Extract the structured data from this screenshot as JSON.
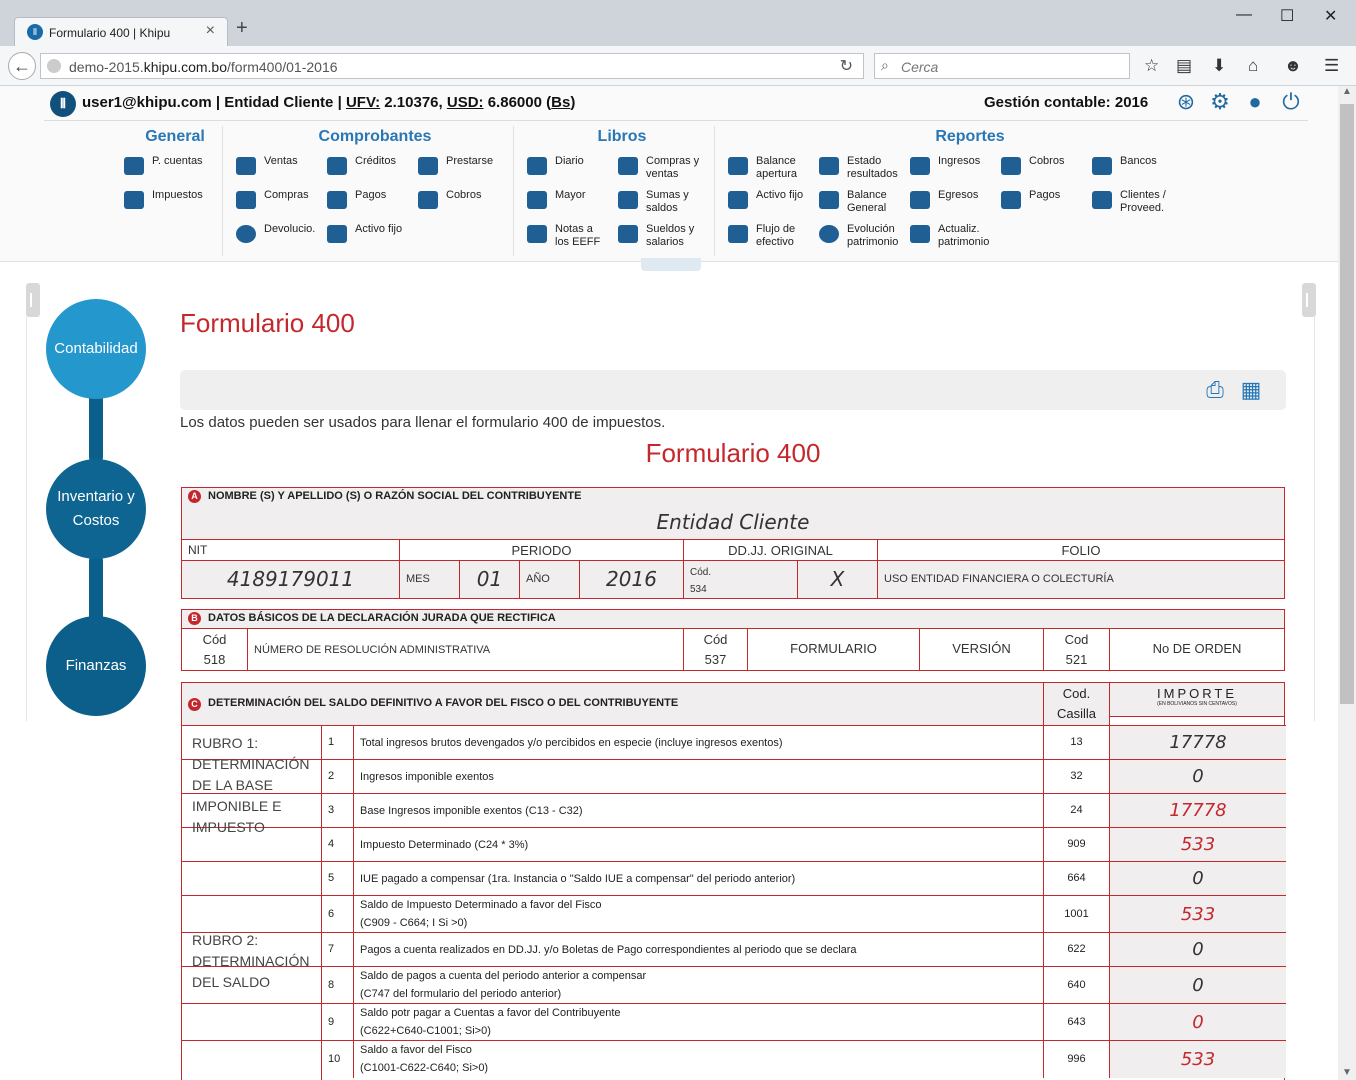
{
  "browser": {
    "tab_title": "Formulario 400 | Khipu",
    "url_prefix": "demo-2015.",
    "url_domain": "khipu.com.bo",
    "url_path": "/form400/01-2016",
    "search_placeholder": "Cerca"
  },
  "header": {
    "user": "user1@khipu.com",
    "entity": "Entidad Cliente",
    "ufv_label": "UFV:",
    "ufv_value": "2.10376",
    "usd_label": "USD:",
    "usd_value": "6.86000",
    "bs_label": "Bs",
    "gestion": "Gestión contable: 2016"
  },
  "menu": {
    "general": {
      "title": "General",
      "items": [
        "P. cuentas",
        "Impuestos"
      ]
    },
    "comprobantes": {
      "title": "Comprobantes",
      "items": [
        "Ventas",
        "Créditos",
        "Prestarse",
        "Compras",
        "Pagos",
        "Cobros",
        "Devolucio.",
        "Activo fijo"
      ]
    },
    "libros": {
      "title": "Libros",
      "items": [
        "Diario",
        "Compras y ventas",
        "Mayor",
        "Sumas y saldos",
        "Notas a los EEFF",
        "Sueldos y salarios"
      ]
    },
    "reportes": {
      "title": "Reportes",
      "items": [
        "Balance apertura",
        "Estado resultados",
        "Ingresos",
        "Cobros",
        "Bancos",
        "Activo fijo",
        "Balance General",
        "Egresos",
        "Pagos",
        "Clientes / Proveed.",
        "Flujo de efectivo",
        "Evolución patrimonio",
        "Actualiz. patrimonio"
      ]
    }
  },
  "sidebar": {
    "items": [
      "Contabilidad",
      "Inventario y Costos",
      "Finanzas"
    ],
    "colors": [
      "#2497cd",
      "#0f6591",
      "#0d5f8b"
    ]
  },
  "page": {
    "title": "Formulario 400",
    "description": "Los datos pueden ser usados para llenar el formulario 400 de impuestos.",
    "form_title": "Formulario 400"
  },
  "form": {
    "secA": {
      "badge": "A",
      "heading": "NOMBRE (S) Y APELLIDO (S) O RAZÓN SOCIAL DEL CONTRIBUYENTE",
      "name": "Entidad Cliente",
      "nit_label": "NIT",
      "periodo_label": "PERIODO",
      "ddjj_label": "DD.JJ. ORIGINAL",
      "folio_label": "FOLIO",
      "nit": "4189179011",
      "mes_label": "MES",
      "mes": "01",
      "anio_label": "AÑO",
      "anio": "2016",
      "cod_label": "Cód.",
      "cod": "534",
      "mark": "X",
      "folio_text": "USO ENTIDAD FINANCIERA O COLECTURÍA"
    },
    "secB": {
      "badge": "B",
      "heading": "DATOS BÁSICOS DE LA DECLARACIÓN JURADA QUE RECTIFICA",
      "cod1_label": "Cód",
      "cod1": "518",
      "resol": "NÚMERO DE RESOLUCIÓN ADMINISTRATIVA",
      "cod2_label": "Cód",
      "cod2": "537",
      "formulario": "FORMULARIO",
      "version": "VERSIÓN",
      "cod3_label": "Cod",
      "cod3": "521",
      "orden": "No DE ORDEN"
    },
    "secC": {
      "badge": "C",
      "heading": "DETERMINACIÓN DEL SALDO DEFINITIVO A FAVOR DEL FISCO O DEL CONTRIBUYENTE",
      "cod_label_1": "Cod.",
      "cod_label_2": "Casilla",
      "importe": "IMPORTE",
      "importe_sub": "(EN BOLIVIANOS SIN CENTAVOS)",
      "rubro1": "RUBRO 1: DETERMINACIÓN DE LA BASE IMPONIBLE E IMPUESTO",
      "rubro2": "RUBRO 2: DETERMINACIÓN DEL SALDO",
      "rows": [
        {
          "n": "1",
          "t1": "Total ingresos brutos devengados y/o percibidos en especie (incluye ingresos exentos)",
          "t2": "",
          "cod": "13",
          "imp": "17778",
          "red": false
        },
        {
          "n": "2",
          "t1": "Ingresos imponible exentos",
          "t2": "",
          "cod": "32",
          "imp": "0",
          "red": false
        },
        {
          "n": "3",
          "t1": "Base Ingresos imponible exentos (C13 - C32)",
          "t2": "",
          "cod": "24",
          "imp": "17778",
          "red": true
        },
        {
          "n": "4",
          "t1": "Impuesto Determinado (C24 * 3%)",
          "t2": "",
          "cod": "909",
          "imp": "533",
          "red": true
        },
        {
          "n": "5",
          "t1": "IUE pagado a compensar (1ra. Instancia o \"Saldo IUE a compensar\" del periodo anterior)",
          "t2": "",
          "cod": "664",
          "imp": "0",
          "red": false
        },
        {
          "n": "6",
          "t1": "Saldo de Impuesto Determinado a favor del Fisco",
          "t2": "(C909 - C664; I Si >0)",
          "cod": "1001",
          "imp": "533",
          "red": true
        },
        {
          "n": "7",
          "t1": "Pagos a cuenta realizados en DD.JJ. y/o Boletas de Pago correspondientes al periodo que se declara",
          "t2": "",
          "cod": "622",
          "imp": "0",
          "red": false
        },
        {
          "n": "8",
          "t1": "Saldo de pagos a cuenta del periodo anterior a compensar",
          "t2": "(C747 del formulario del periodo anterior)",
          "cod": "640",
          "imp": "0",
          "red": false
        },
        {
          "n": "9",
          "t1": "Saldo potr pagar a Cuentas a favor del Contribuyente",
          "t2": "(C622+C640-C1001; Si>0)",
          "cod": "643",
          "imp": "0",
          "red": true
        },
        {
          "n": "10",
          "t1": "Saldo a favor del Fisco",
          "t2": "(C1001-C622-C640; Si>0)",
          "cod": "996",
          "imp": "533",
          "red": true
        }
      ]
    }
  },
  "icons": [
    "back-arrow-icon",
    "globe-icon",
    "reload-icon",
    "search-icon",
    "star-icon",
    "reader-icon",
    "download-icon",
    "home-icon",
    "chat-icon",
    "menu-icon",
    "help-icon",
    "gear-icon",
    "user-icon",
    "power-icon",
    "print-icon",
    "table-icon"
  ]
}
